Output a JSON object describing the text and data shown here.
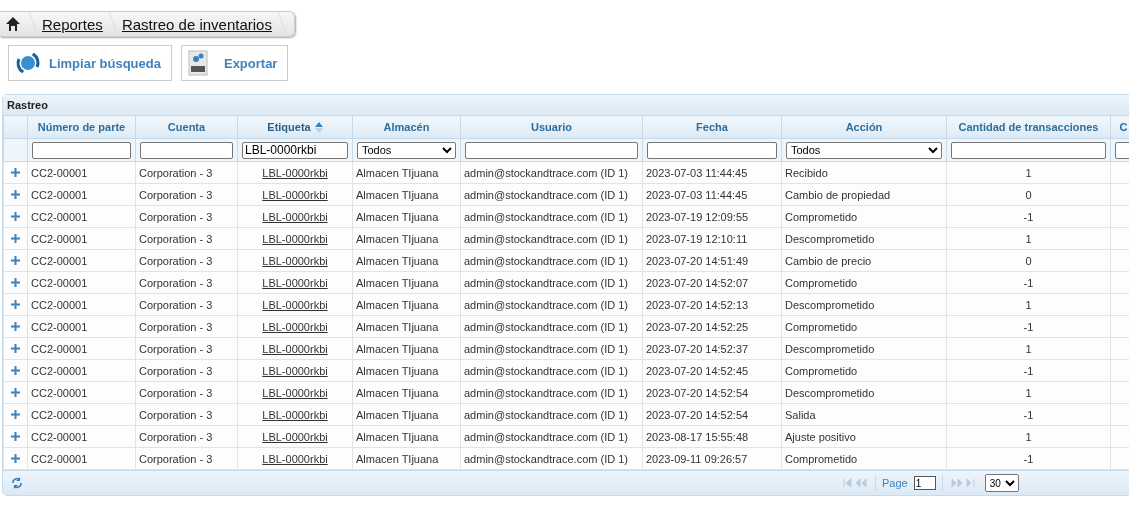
{
  "breadcrumb": [
    "Reportes",
    "Rastreo de inventarios"
  ],
  "toolbar": [
    {
      "label": "Limpiar búsqueda",
      "kind": "clear"
    },
    {
      "label": "Exportar",
      "kind": "csv"
    }
  ],
  "grid": {
    "caption": "Rastreo",
    "columns": [
      {
        "label": "Número de parte",
        "kind": "text",
        "sorted": false
      },
      {
        "label": "Cuenta",
        "kind": "text",
        "sorted": false
      },
      {
        "label": "Etiqueta",
        "kind": "text",
        "value": "LBL-0000rkbi",
        "sorted": true
      },
      {
        "label": "Almacén",
        "kind": "select",
        "value": "Todos",
        "sorted": false
      },
      {
        "label": "Usuario",
        "kind": "text",
        "sorted": false
      },
      {
        "label": "Fecha",
        "kind": "text",
        "sorted": false
      },
      {
        "label": "Acción",
        "kind": "select",
        "value": "Todos",
        "sorted": false
      },
      {
        "label": "Cantidad de transacciones",
        "kind": "text",
        "sorted": false
      },
      {
        "label": "C",
        "kind": "text",
        "sorted": false
      }
    ],
    "rows": [
      [
        "CC2-00001",
        "Corporation - 3",
        "LBL-0000rkbi",
        "Almacen TIjuana",
        "admin@stockandtrace.com (ID 1)",
        "2023-07-03 11:44:45",
        "Recibido",
        "1"
      ],
      [
        "CC2-00001",
        "Corporation - 3",
        "LBL-0000rkbi",
        "Almacen TIjuana",
        "admin@stockandtrace.com (ID 1)",
        "2023-07-03 11:44:45",
        "Cambio de propiedad",
        "0"
      ],
      [
        "CC2-00001",
        "Corporation - 3",
        "LBL-0000rkbi",
        "Almacen TIjuana",
        "admin@stockandtrace.com (ID 1)",
        "2023-07-19 12:09:55",
        "Comprometido",
        "-1"
      ],
      [
        "CC2-00001",
        "Corporation - 3",
        "LBL-0000rkbi",
        "Almacen TIjuana",
        "admin@stockandtrace.com (ID 1)",
        "2023-07-19 12:10:11",
        "Descomprometido",
        "1"
      ],
      [
        "CC2-00001",
        "Corporation - 3",
        "LBL-0000rkbi",
        "Almacen TIjuana",
        "admin@stockandtrace.com (ID 1)",
        "2023-07-20 14:51:49",
        "Cambio de precio",
        "0"
      ],
      [
        "CC2-00001",
        "Corporation - 3",
        "LBL-0000rkbi",
        "Almacen TIjuana",
        "admin@stockandtrace.com (ID 1)",
        "2023-07-20 14:52:07",
        "Comprometido",
        "-1"
      ],
      [
        "CC2-00001",
        "Corporation - 3",
        "LBL-0000rkbi",
        "Almacen TIjuana",
        "admin@stockandtrace.com (ID 1)",
        "2023-07-20 14:52:13",
        "Descomprometido",
        "1"
      ],
      [
        "CC2-00001",
        "Corporation - 3",
        "LBL-0000rkbi",
        "Almacen TIjuana",
        "admin@stockandtrace.com (ID 1)",
        "2023-07-20 14:52:25",
        "Comprometido",
        "-1"
      ],
      [
        "CC2-00001",
        "Corporation - 3",
        "LBL-0000rkbi",
        "Almacen TIjuana",
        "admin@stockandtrace.com (ID 1)",
        "2023-07-20 14:52:37",
        "Descomprometido",
        "1"
      ],
      [
        "CC2-00001",
        "Corporation - 3",
        "LBL-0000rkbi",
        "Almacen TIjuana",
        "admin@stockandtrace.com (ID 1)",
        "2023-07-20 14:52:45",
        "Comprometido",
        "-1"
      ],
      [
        "CC2-00001",
        "Corporation - 3",
        "LBL-0000rkbi",
        "Almacen TIjuana",
        "admin@stockandtrace.com (ID 1)",
        "2023-07-20 14:52:54",
        "Descomprometido",
        "1"
      ],
      [
        "CC2-00001",
        "Corporation - 3",
        "LBL-0000rkbi",
        "Almacen TIjuana",
        "admin@stockandtrace.com (ID 1)",
        "2023-07-20 14:52:54",
        "Salida",
        "-1"
      ],
      [
        "CC2-00001",
        "Corporation - 3",
        "LBL-0000rkbi",
        "Almacen TIjuana",
        "admin@stockandtrace.com (ID 1)",
        "2023-08-17 15:55:48",
        "Ajuste positivo",
        "1"
      ],
      [
        "CC2-00001",
        "Corporation - 3",
        "LBL-0000rkbi",
        "Almacen TIjuana",
        "admin@stockandtrace.com (ID 1)",
        "2023-09-11 09:26:57",
        "Comprometido",
        "-1"
      ]
    ]
  },
  "pager": {
    "label": "Page",
    "page": "1",
    "page_size": "30"
  }
}
